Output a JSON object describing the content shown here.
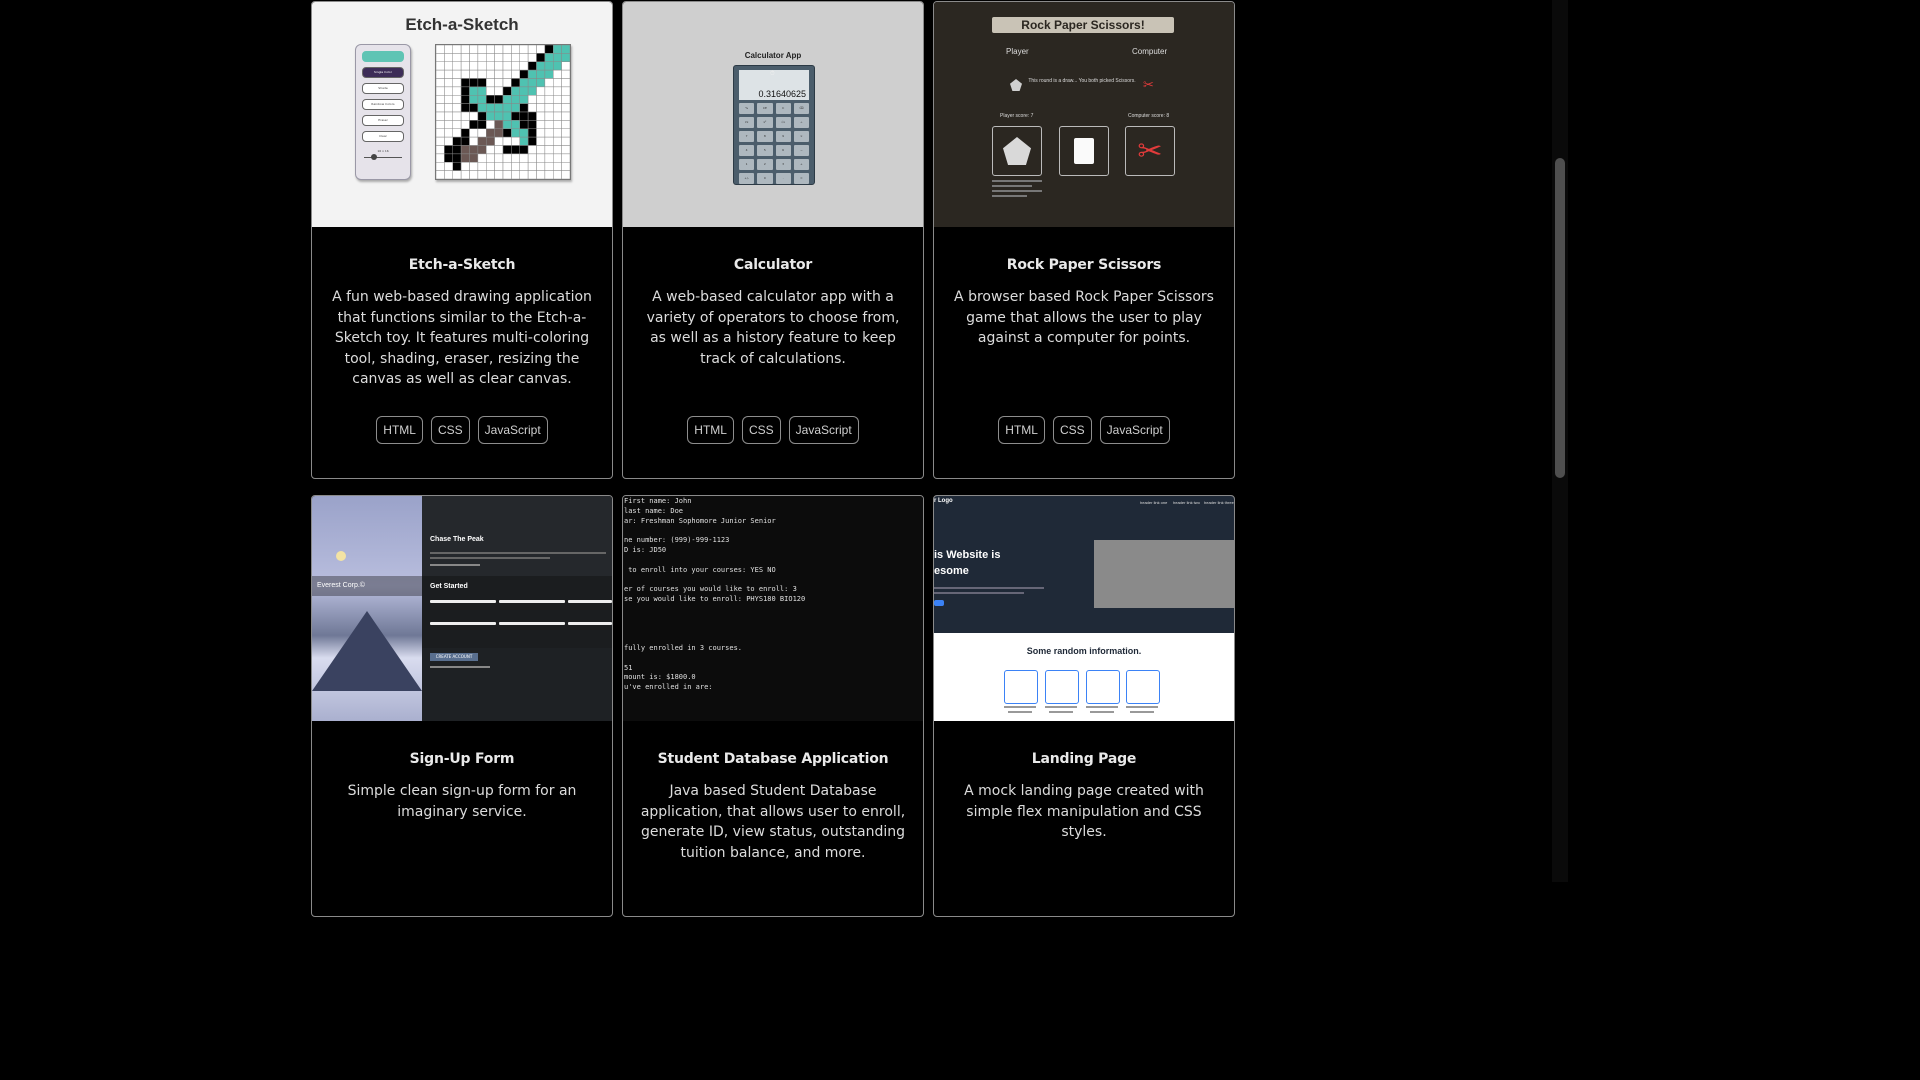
{
  "projects": [
    {
      "title": "Etch-a-Sketch",
      "description": "A fun web-based drawing application that functions similar to the Etch-a-Sketch toy. It features multi-coloring tool, shading, eraser, resizing the canvas as well as clear canvas.",
      "tags": [
        "HTML",
        "CSS",
        "JavaScript"
      ],
      "thumb": {
        "heading": "Etch-a-Sketch",
        "buttons": [
          "",
          "Single Color",
          "Shade",
          "Rainbow Colors",
          "Eraser",
          "Clear"
        ],
        "size_label": "16 x 16"
      }
    },
    {
      "title": "Calculator",
      "description": "A web-based calculator app with a variety of operators to choose from, as well as a history feature to keep track of calculations.",
      "tags": [
        "HTML",
        "CSS",
        "JavaScript"
      ],
      "thumb": {
        "heading": "Calculator App",
        "display_value": "0.31640625",
        "keys": [
          "%",
          "CE",
          "C",
          "⌫",
          "⅟x",
          "x²",
          "√x",
          "÷",
          "7",
          "8",
          "9",
          "×",
          "4",
          "5",
          "6",
          "−",
          "1",
          "2",
          "3",
          "+",
          "+/-",
          "0",
          ".",
          "="
        ]
      }
    },
    {
      "title": "Rock Paper Scissors",
      "description": "A browser based Rock Paper Scissors game that allows the user to play against a computer for points.",
      "tags": [
        "HTML",
        "CSS",
        "JavaScript"
      ],
      "thumb": {
        "heading": "Rock Paper Scissors!",
        "player_label": "Player",
        "computer_label": "Computer",
        "message": "This round is a draw... You both picked Scissors.",
        "player_score": "Player score: 7",
        "computer_score": "Computer score: 8"
      }
    },
    {
      "title": "Sign-Up Form",
      "description": "Simple clean sign-up form for an imaginary service.",
      "tags": [],
      "thumb": {
        "logo": "Everest Corp.©",
        "heading": "Chase The Peak",
        "form_title": "Get Started",
        "create_button": "CREATE ACCOUNT"
      }
    },
    {
      "title": "Student Database Application",
      "description": "Java based Student Database application, that allows user to enroll, generate ID, view status, outstanding tuition balance, and more.",
      "tags": [],
      "thumb": {
        "console_lines": [
          "First name: John",
          "last name: Doe",
          "ar: Freshman Sophomore Junior Senior",
          "",
          "ne number: (999)-999-1123",
          "D is: JD50",
          "",
          " to enroll into your courses: YES NO",
          "",
          "er of courses you would like to enroll: 3",
          "se you would like to enroll: PHYS180 BIO120",
          "",
          "",
          "",
          "",
          "fully enrolled in 3 courses.",
          "",
          "51",
          "mount is: $1800.0",
          "u've enrolled in are:"
        ]
      }
    },
    {
      "title": "Landing Page",
      "description": "A mock landing page created with simple flex manipulation and CSS styles.",
      "tags": [],
      "thumb": {
        "logo": "r Logo",
        "hero_line1": "is Website is",
        "hero_line2": "esome",
        "section_heading": "Some random information.",
        "nav": [
          "header link one",
          "header link two",
          "header link three"
        ]
      }
    }
  ]
}
